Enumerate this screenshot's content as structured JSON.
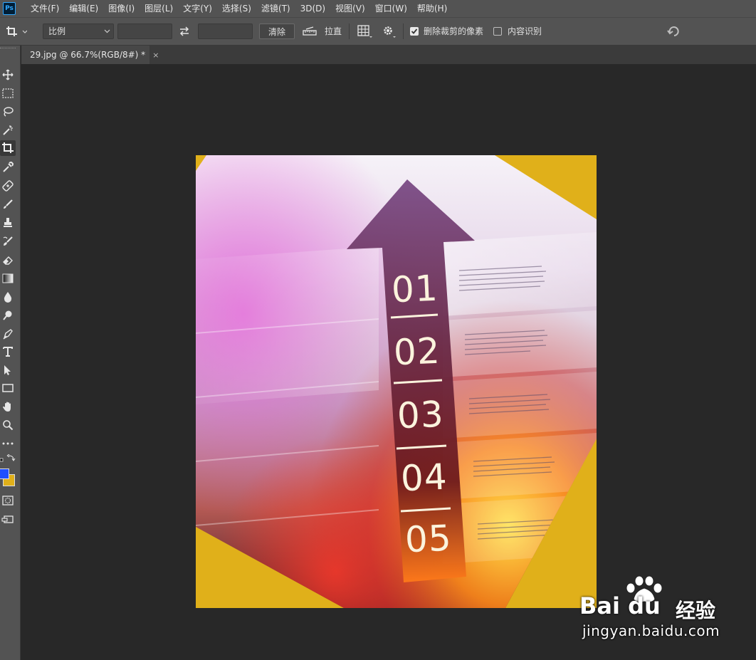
{
  "app": {
    "logo_text": "Ps"
  },
  "menu": [
    {
      "id": "file",
      "label": "文件(F)"
    },
    {
      "id": "edit",
      "label": "编辑(E)"
    },
    {
      "id": "image",
      "label": "图像(I)"
    },
    {
      "id": "layer",
      "label": "图层(L)"
    },
    {
      "id": "type",
      "label": "文字(Y)"
    },
    {
      "id": "select",
      "label": "选择(S)"
    },
    {
      "id": "filter",
      "label": "滤镜(T)"
    },
    {
      "id": "3d",
      "label": "3D(D)"
    },
    {
      "id": "view",
      "label": "视图(V)"
    },
    {
      "id": "window",
      "label": "窗口(W)"
    },
    {
      "id": "help",
      "label": "帮助(H)"
    }
  ],
  "options": {
    "ratio_select_value": "比例",
    "width_value": "",
    "height_value": "",
    "clear_label": "清除",
    "straighten_label": "拉直",
    "delete_cropped_label": "删除裁剪的像素",
    "delete_cropped_checked": true,
    "content_aware_label": "内容识别",
    "content_aware_checked": false
  },
  "document": {
    "tab_label": "29.jpg @ 66.7%(RGB/8#) *",
    "close_symbol": "×"
  },
  "canvas_image": {
    "step_numbers": [
      "01",
      "02",
      "03",
      "04",
      "05"
    ]
  },
  "colors": {
    "foreground": "#1f4fff",
    "background": "#e0b01a",
    "crop_fill": "#e0b01a",
    "ui_dark": "#535353",
    "workspace": "#282828"
  },
  "watermark": {
    "brand": "Bai du",
    "product": "经验",
    "url": "jingyan.baidu.com"
  }
}
